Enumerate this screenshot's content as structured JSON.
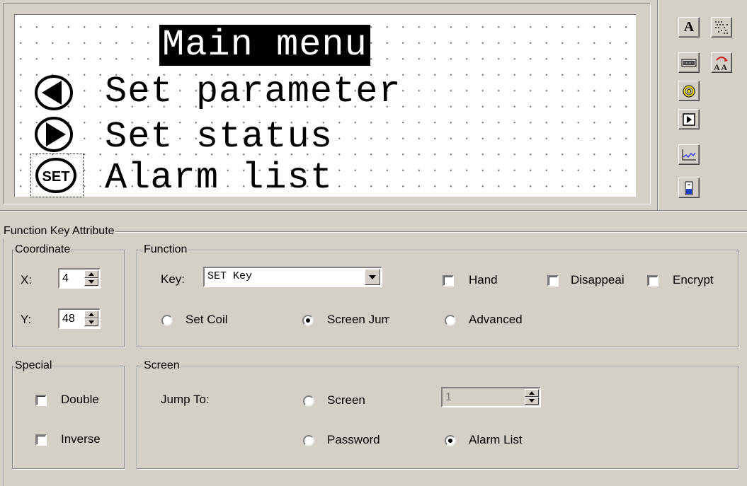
{
  "lcd": {
    "title": "Main menu",
    "items": [
      {
        "label": "Set parameter",
        "icon": "left-arrow-key-icon"
      },
      {
        "label": "Set status",
        "icon": "right-arrow-key-icon"
      },
      {
        "label": "Alarm list",
        "icon": "set-key-icon",
        "icon_text": "SET"
      }
    ]
  },
  "toolbox": {
    "buttons": [
      {
        "name": "text-tool-icon",
        "glyph": "A"
      },
      {
        "name": "function-key-tool-icon"
      },
      {
        "name": "lamp-tool-icon"
      },
      {
        "name": "screen-button-tool-icon"
      },
      {
        "name": "trend-graph-tool-icon"
      },
      {
        "name": "bar-graph-tool-icon"
      },
      {
        "name": "group-tool-icon"
      },
      {
        "name": "alternating-text-tool-icon",
        "glyph": "A A"
      }
    ]
  },
  "attribute_panel": {
    "title": "Function Key Attribute",
    "coordinate": {
      "title": "Coordinate",
      "x_label": "X:",
      "x_value": "4",
      "y_label": "Y:",
      "y_value": "48"
    },
    "function": {
      "title": "Function",
      "key_label": "Key:",
      "key_value": "SET Key",
      "hand_label": "Hand",
      "disappear_label": "Disappeai",
      "encrypt_label": "Encrypt",
      "set_coil_label": "Set Coil",
      "screen_jump_label": "Screen Jum",
      "advanced_label": "Advanced",
      "selected_mode": "Screen Jump"
    },
    "special": {
      "title": "Special",
      "double_label": "Double",
      "inverse_label": "Inverse"
    },
    "screen": {
      "title": "Screen",
      "jump_to_label": "Jump To:",
      "screen_label": "Screen",
      "screen_number": "1",
      "password_label": "Password",
      "alarm_list_label": "Alarm List",
      "selected_target": "Alarm List"
    }
  },
  "colors": {
    "face": "#d4d0c8",
    "lcd_background": "#ffffff",
    "lcd_dots": "#7d7d7d"
  }
}
